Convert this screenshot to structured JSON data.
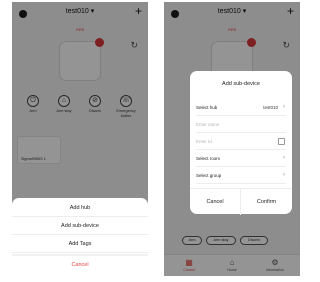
{
  "left": {
    "header": {
      "hub_name": "test010 ▾",
      "plus": "+"
    },
    "arm_label": "Arm",
    "modes": [
      {
        "icon": "⏻",
        "label": "Arm"
      },
      {
        "icon": "⌂",
        "label": "Arm stay"
      },
      {
        "icon": "⊘",
        "label": "Disarm"
      },
      {
        "icon": "☏",
        "label": "Emergency button"
      }
    ],
    "device_name": "Sigma9985S 1",
    "sheet": {
      "add_hub": "Add hub",
      "add_subdevice": "Add sub-device",
      "add_tags": "Add Tags",
      "cancel": "Cancel"
    }
  },
  "right": {
    "header": {
      "hub_name": "test010 ▾",
      "plus": "+"
    },
    "arm_label": "Arm",
    "dialog": {
      "title": "Add sub-device",
      "select_hub_label": "Select hub",
      "select_hub_value": "test010",
      "name_placeholder": "Enter name",
      "id_placeholder": "Enter Id",
      "select_room_label": "Select room",
      "select_group_label": "Select group",
      "cancel": "Cancel",
      "confirm": "Confirm"
    },
    "chips": [
      "Arm",
      "Arm stay",
      "Disarm"
    ],
    "tabs": [
      {
        "icon": "▦",
        "label": "Control"
      },
      {
        "icon": "⌂",
        "label": "Home"
      },
      {
        "icon": "⚙",
        "label": "Information"
      }
    ]
  },
  "colors": {
    "accent": "#e3453d",
    "panel_dot": "#d9363e"
  }
}
